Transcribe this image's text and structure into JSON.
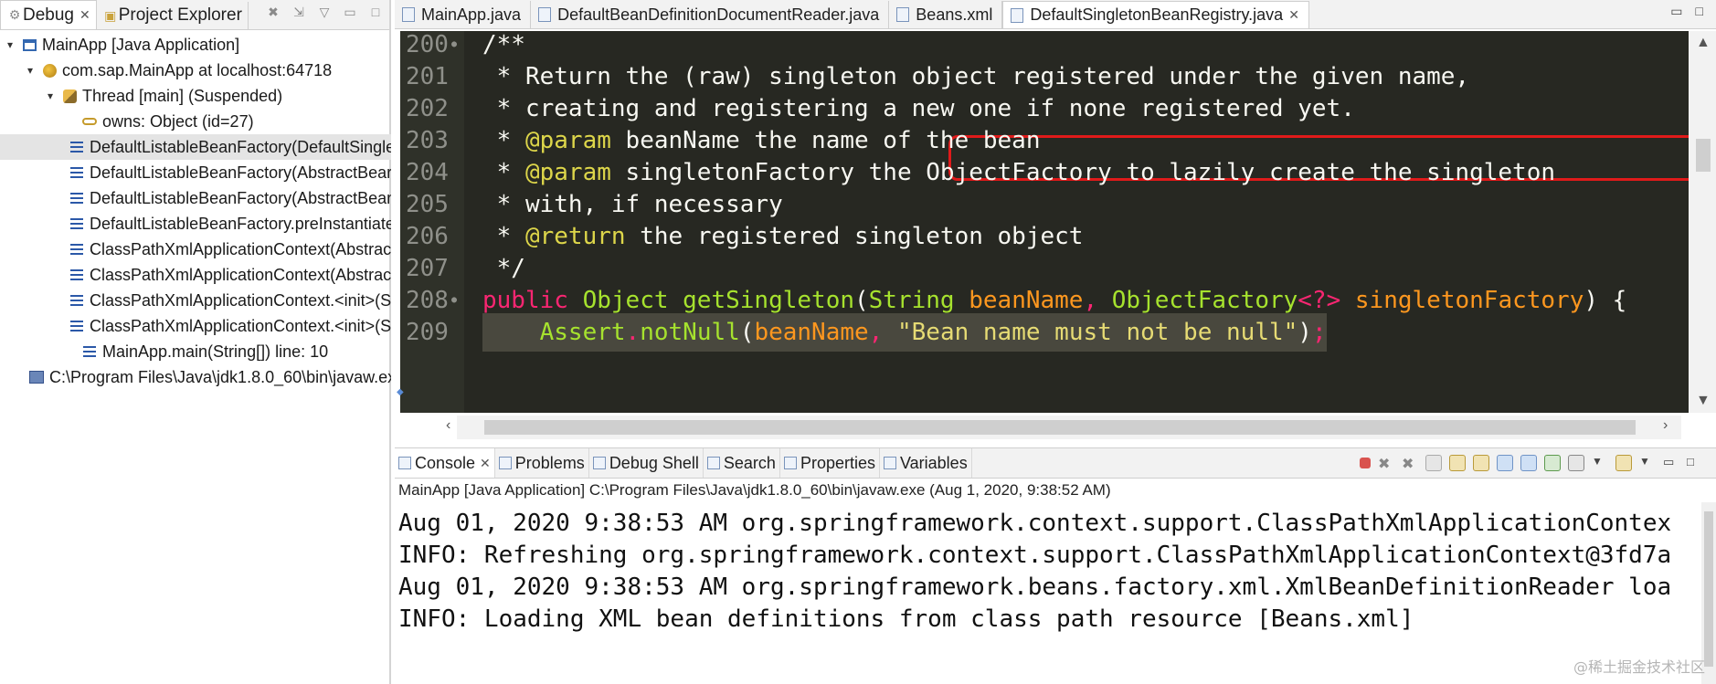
{
  "left_panel": {
    "tabs": [
      {
        "label": "Debug",
        "active": true
      },
      {
        "label": "Project Explorer",
        "active": false
      }
    ],
    "tree": [
      {
        "text": "MainApp [Java Application]",
        "icon": "app-icon"
      },
      {
        "text": "com.sap.MainApp at localhost:64718",
        "icon": "package-icon"
      },
      {
        "text": "Thread [main] (Suspended)",
        "icon": "thread-icon"
      },
      {
        "text": "owns: Object  (id=27)",
        "icon": "key-icon"
      },
      {
        "text": "DefaultListableBeanFactory(DefaultSingle",
        "icon": "stack-frame-icon",
        "selected": true
      },
      {
        "text": "DefaultListableBeanFactory(AbstractBear",
        "icon": "stack-frame-icon"
      },
      {
        "text": "DefaultListableBeanFactory(AbstractBean",
        "icon": "stack-frame-icon"
      },
      {
        "text": "DefaultListableBeanFactory.preInstantiate",
        "icon": "stack-frame-icon"
      },
      {
        "text": "ClassPathXmlApplicationContext(Abstrac",
        "icon": "stack-frame-icon"
      },
      {
        "text": "ClassPathXmlApplicationContext(Abstrac",
        "icon": "stack-frame-icon"
      },
      {
        "text": "ClassPathXmlApplicationContext.<init>(S",
        "icon": "stack-frame-icon"
      },
      {
        "text": "ClassPathXmlApplicationContext.<init>(S",
        "icon": "stack-frame-icon"
      },
      {
        "text": "MainApp.main(String[]) line: 10",
        "icon": "stack-frame-icon"
      },
      {
        "text": "C:\\Program Files\\Java\\jdk1.8.0_60\\bin\\javaw.ex",
        "icon": "process-icon"
      }
    ]
  },
  "editor": {
    "tabs": [
      {
        "label": "MainApp.java",
        "active": false
      },
      {
        "label": "DefaultBeanDefinitionDocumentReader.java",
        "active": false
      },
      {
        "label": "Beans.xml",
        "active": false
      },
      {
        "label": "DefaultSingletonBeanRegistry.java",
        "active": true
      }
    ],
    "lines": [
      {
        "num": "200",
        "fold": true,
        "tokens": [
          [
            "c-com",
            "/**"
          ]
        ]
      },
      {
        "num": "201",
        "tokens": [
          [
            "c-com",
            " * Return the (raw) singleton object registered under the given name,"
          ]
        ]
      },
      {
        "num": "202",
        "tokens": [
          [
            "c-com",
            " * creating and registering a new one if none registered yet."
          ]
        ]
      },
      {
        "num": "203",
        "tokens": [
          [
            "c-com",
            " * "
          ],
          [
            "c-tag",
            "@param"
          ],
          [
            "c-com",
            " beanName the name of the bean"
          ]
        ]
      },
      {
        "num": "204",
        "tokens": [
          [
            "c-com",
            " * "
          ],
          [
            "c-tag",
            "@param"
          ],
          [
            "c-com",
            " singletonFactory the ObjectFactory to lazily create the singleton"
          ]
        ]
      },
      {
        "num": "205",
        "tokens": [
          [
            "c-com",
            " * with, if necessary"
          ]
        ]
      },
      {
        "num": "206",
        "tokens": [
          [
            "c-com",
            " * "
          ],
          [
            "c-tag",
            "@return"
          ],
          [
            "c-com",
            " the registered singleton object"
          ]
        ]
      },
      {
        "num": "207",
        "tokens": [
          [
            "c-com",
            " */"
          ]
        ]
      },
      {
        "num": "208",
        "fold": true,
        "tokens": [
          [
            "c-kw",
            "public"
          ],
          [
            "c-id",
            " "
          ],
          [
            "c-type",
            "Object"
          ],
          [
            "c-id",
            " "
          ],
          [
            "c-type",
            "getSingleton"
          ],
          [
            "c-id",
            "("
          ],
          [
            "c-type",
            "String"
          ],
          [
            "c-id",
            " "
          ],
          [
            "c-par",
            "beanName"
          ],
          [
            "c-kw",
            ","
          ],
          [
            "c-id",
            " "
          ],
          [
            "c-type",
            "ObjectFactory"
          ],
          [
            "c-kw",
            "<?>"
          ],
          [
            "c-id",
            " "
          ],
          [
            "c-par",
            "singletonFactory"
          ],
          [
            "c-id",
            ") {"
          ]
        ]
      },
      {
        "num": "209",
        "highlight": true,
        "tokens": [
          [
            "c-id",
            "    "
          ],
          [
            "c-type",
            "Assert"
          ],
          [
            "c-kw",
            "."
          ],
          [
            "c-type",
            "notNull"
          ],
          [
            "c-id",
            "("
          ],
          [
            "c-par",
            "beanName"
          ],
          [
            "c-kw",
            ","
          ],
          [
            "c-id",
            " "
          ],
          [
            "c-str",
            "\"Bean name must not be null\""
          ],
          [
            "c-id",
            ")"
          ],
          [
            "c-kw",
            ";"
          ]
        ]
      }
    ]
  },
  "console_panel": {
    "tabs": [
      {
        "label": "Console",
        "active": true,
        "closable": true
      },
      {
        "label": "Problems"
      },
      {
        "label": "Debug Shell"
      },
      {
        "label": "Search"
      },
      {
        "label": "Properties"
      },
      {
        "label": "Variables"
      }
    ],
    "description": "MainApp [Java Application] C:\\Program Files\\Java\\jdk1.8.0_60\\bin\\javaw.exe (Aug 1, 2020, 9:38:52 AM)",
    "lines": [
      "Aug 01, 2020 9:38:53 AM org.springframework.context.support.ClassPathXmlApplicationContex",
      "INFO: Refreshing org.springframework.context.support.ClassPathXmlApplicationContext@3fd7a",
      "Aug 01, 2020 9:38:53 AM org.springframework.beans.factory.xml.XmlBeanDefinitionReader loa",
      "INFO: Loading XML bean definitions from class path resource [Beans.xml]"
    ],
    "watermark": "@稀土掘金技术社区"
  },
  "colors": {
    "editor_bg": "#272822",
    "highlight_box": "#e01a1a",
    "keyword": "#f92672",
    "type": "#a6e22e",
    "param": "#fd971f",
    "string": "#e6db74",
    "javadoc_tag": "#ddd64a"
  }
}
